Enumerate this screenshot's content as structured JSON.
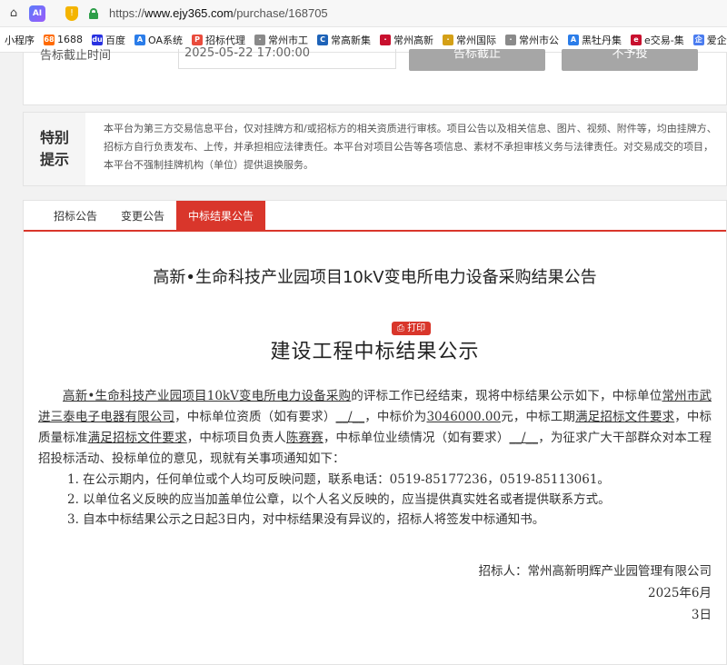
{
  "browser": {
    "url_prefix": "https://",
    "url_host": "www.ejy365.com",
    "url_path": "/purchase/168705",
    "ai_label": "AI"
  },
  "bookmarks": [
    {
      "label": "小程序",
      "color": "#ffffff",
      "text_color": "#222",
      "icon": ""
    },
    {
      "label": "1688",
      "color": "#ff6a00",
      "icon": "1688"
    },
    {
      "label": "百度",
      "color": "#2932e1",
      "icon": "du"
    },
    {
      "label": "OA系统",
      "color": "#2b7de9",
      "icon": "A"
    },
    {
      "label": "招标代理",
      "color": "#e94b3c",
      "icon": "P"
    },
    {
      "label": "常州市工",
      "color": "#8a8a8a",
      "icon": "·"
    },
    {
      "label": "常高新集",
      "color": "#1e63b8",
      "icon": "C"
    },
    {
      "label": "常州高新",
      "color": "#c8102e",
      "icon": "·"
    },
    {
      "label": "常州国际",
      "color": "#d4a017",
      "icon": "·"
    },
    {
      "label": "常州市公",
      "color": "#8a8a8a",
      "icon": "·"
    },
    {
      "label": "黑牡丹集",
      "color": "#2b7de9",
      "icon": "A"
    },
    {
      "label": "e交易-集",
      "color": "#c8102e",
      "icon": "e"
    },
    {
      "label": "爱企查首",
      "color": "#4a7cf0",
      "icon": "企"
    }
  ],
  "top_card": {
    "deadline_label": "告标截止时间",
    "deadline_value": "2025-05-22 17:00:00",
    "button_left": "告标截止",
    "button_right": "不予投"
  },
  "notice": {
    "title_line1": "特别",
    "title_line2": "提示",
    "text": "本平台为第三方交易信息平台，仅对挂牌方和/或招标方的相关资质进行审核。项目公告以及相关信息、图片、视频、附件等，均由挂牌方、招标方自行负责发布、上传，并承担相应法律责任。本平台对项目公告等各项信息、素材不承担审核义务与法律责任。对交易成交的项目，本平台不强制挂牌机构（单位）提供退换服务。"
  },
  "tabs": [
    {
      "label": "招标公告",
      "active": false
    },
    {
      "label": "变更公告",
      "active": false
    },
    {
      "label": "中标结果公告",
      "active": true
    }
  ],
  "announcement": {
    "title": "高新•生命科技产业园项目10kV变电所电力设备采购结果公告",
    "print_label": "打印",
    "subtitle": "建设工程中标结果公示",
    "project_name": "高新•生命科技产业园项目10kV变电所电力设备采购",
    "p_1": "的评标工作已经结束，现将中标结果公示如下，中标单位",
    "winner": "常州市武进三泰电子电器有限公司",
    "p_2": "，中标单位资质（如有要求）",
    "qualification": "__/__",
    "p_3": "，中标价为",
    "price": "3046000.00",
    "p_4": "元，中标工期",
    "period": "满足招标文件要求",
    "p_5": "，中标质量标准",
    "quality": "满足招标文件要求",
    "p_6": "，中标项目负责人",
    "manager": "陈赛赛",
    "p_7": "，中标单位业绩情况（如有要求）",
    "performance": "__/__",
    "p_8": "，为征求广大干部群众对本工程招投标活动、投标单位的意见，现就有关事项通知如下：",
    "items": [
      "1. 在公示期内，任何单位或个人均可反映问题，联系电话：0519-85177236，0519-85113061。",
      "2. 以单位名义反映的应当加盖单位公章，以个人名义反映的，应当提供真实姓名或者提供联系方式。",
      "3. 自本中标结果公示之日起3日内，对中标结果没有异议的，招标人将签发中标通知书。"
    ],
    "issuer": "招标人：常州高新明辉产业园管理有限公司",
    "date_line1": "2025年6月",
    "date_line2": "3日"
  }
}
